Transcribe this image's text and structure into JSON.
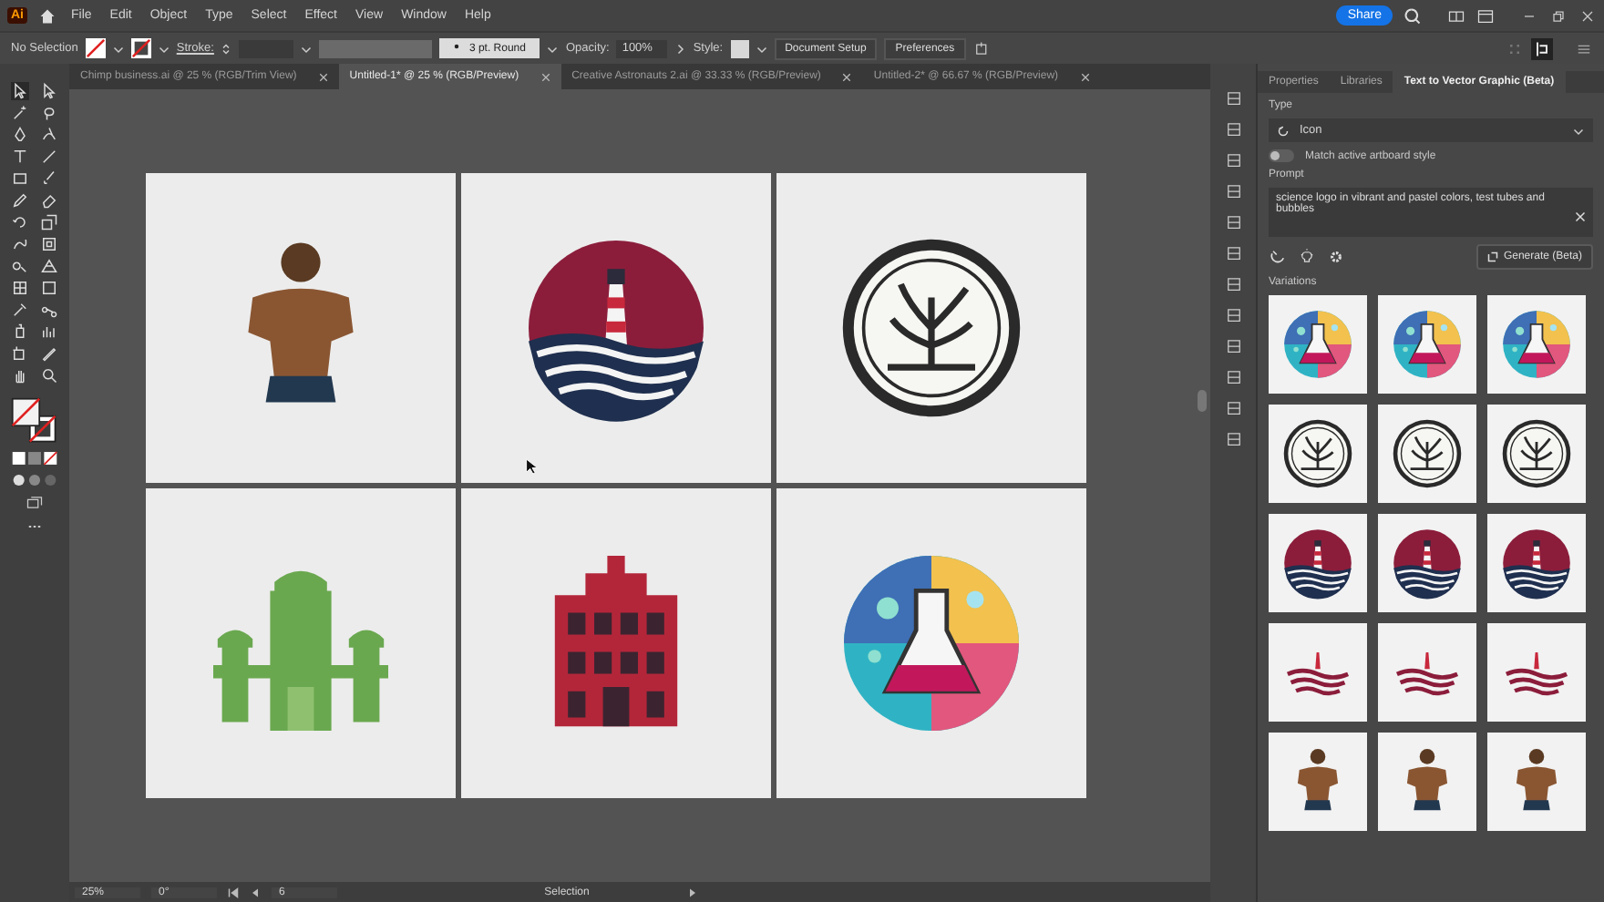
{
  "app_bar": {
    "logo": "Ai",
    "menus": [
      "File",
      "Edit",
      "Object",
      "Type",
      "Select",
      "Effect",
      "View",
      "Window",
      "Help"
    ],
    "share": "Share"
  },
  "control_bar": {
    "selection": "No Selection",
    "stroke_label": "Stroke:",
    "brush": "3 pt. Round",
    "opacity_label": "Opacity:",
    "opacity": "100%",
    "style_label": "Style:",
    "buttons": [
      "Document Setup",
      "Preferences"
    ]
  },
  "document_tabs": [
    {
      "label": "Chimp business.ai @ 25 % (RGB/Trim View)",
      "selected": false
    },
    {
      "label": "Untitled-1* @ 25 % (RGB/Preview)",
      "selected": true
    },
    {
      "label": "Creative Astronauts 2.ai @ 33.33 % (RGB/Preview)",
      "selected": false
    },
    {
      "label": "Untitled-2* @ 66.67 % (RGB/Preview)",
      "selected": false
    }
  ],
  "artboards": [
    {
      "kind": "person"
    },
    {
      "kind": "lighthouse"
    },
    {
      "kind": "plant"
    },
    {
      "kind": "green-building"
    },
    {
      "kind": "red-building"
    },
    {
      "kind": "flask"
    }
  ],
  "panel": {
    "tabs": [
      {
        "label": "Properties",
        "selected": false
      },
      {
        "label": "Libraries",
        "selected": false
      },
      {
        "label": "Text to Vector Graphic (Beta)",
        "selected": true
      }
    ],
    "type_label": "Type",
    "type_value": "Icon",
    "match_style": {
      "label": "Match active artboard style",
      "on": false
    },
    "prompt_label": "Prompt",
    "prompt": "science logo in vibrant and pastel colors, test tubes and bubbles",
    "generate": "Generate (Beta)",
    "variations_label": "Variations",
    "variations": [
      {
        "kind": "flask"
      },
      {
        "kind": "flask"
      },
      {
        "kind": "flask"
      },
      {
        "kind": "plant"
      },
      {
        "kind": "plant"
      },
      {
        "kind": "plant"
      },
      {
        "kind": "lighthouse"
      },
      {
        "kind": "lighthouse"
      },
      {
        "kind": "lighthouse"
      },
      {
        "kind": "waves"
      },
      {
        "kind": "waves"
      },
      {
        "kind": "waves"
      },
      {
        "kind": "person"
      },
      {
        "kind": "person"
      },
      {
        "kind": "person"
      }
    ]
  },
  "status_bar": {
    "zoom": "25%",
    "rotation": "0°",
    "artboard": "6",
    "tool": "Selection"
  }
}
